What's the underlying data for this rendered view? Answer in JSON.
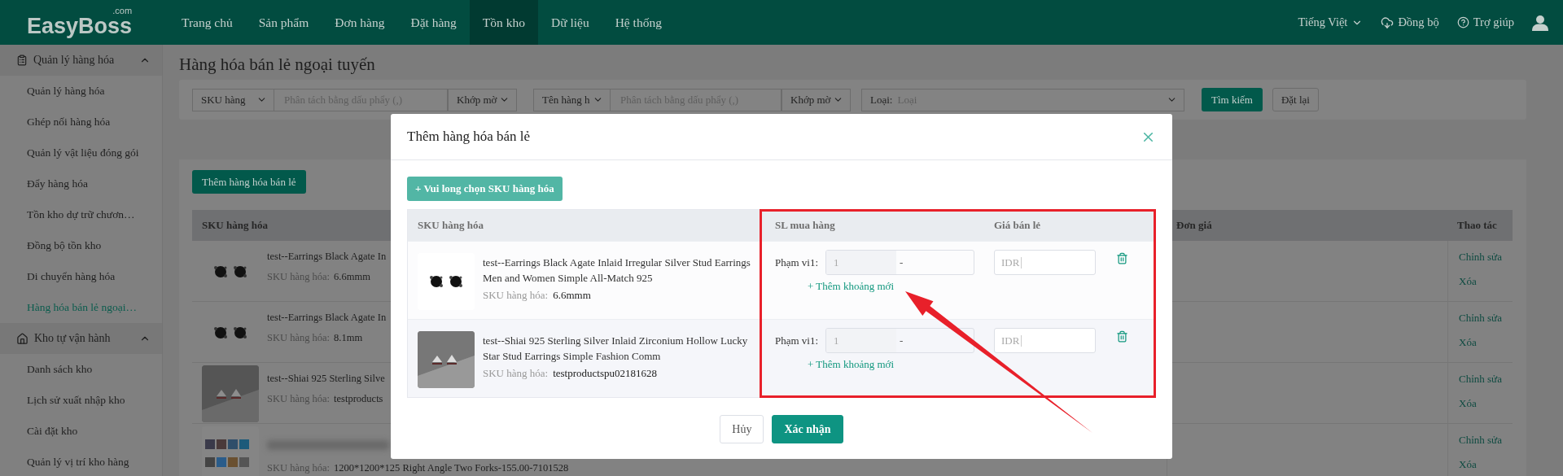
{
  "header": {
    "logo": "EasyBoss",
    "logo_suffix": ".com",
    "nav": [
      {
        "label": "Trang chủ",
        "selected": false
      },
      {
        "label": "Sản phẩm",
        "selected": false
      },
      {
        "label": "Đơn hàng",
        "selected": false
      },
      {
        "label": "Đặt hàng",
        "selected": false
      },
      {
        "label": "Tồn kho",
        "selected": true
      },
      {
        "label": "Dữ liệu",
        "selected": false
      },
      {
        "label": "Hệ thống",
        "selected": false
      }
    ],
    "language": "Tiếng Việt",
    "actions": [
      {
        "kind": "sync",
        "label": "Đồng bộ"
      },
      {
        "kind": "help",
        "label": "Trợ giúp"
      }
    ]
  },
  "sidebar": {
    "groups": [
      {
        "kind": "goods",
        "label": "Quản lý hàng hóa",
        "expanded": true,
        "children": [
          {
            "label": "Quản lý hàng hóa",
            "selected": false
          },
          {
            "label": "Ghép nối hàng hóa",
            "selected": false
          },
          {
            "label": "Quản lý vật liệu đóng gói",
            "selected": false
          },
          {
            "label": "Đẩy hàng hóa",
            "selected": false
          },
          {
            "label": "Tồn kho dự trữ chươn…",
            "selected": false
          },
          {
            "label": "Đồng bộ tồn kho",
            "selected": false
          },
          {
            "label": "Di chuyển hàng hóa",
            "selected": false
          },
          {
            "label": "Hàng hóa bán lẻ ngoại…",
            "selected": true
          }
        ]
      },
      {
        "kind": "warehouse",
        "label": "Kho tự vận hành",
        "expanded": true,
        "children": [
          {
            "label": "Danh sách kho",
            "selected": false
          },
          {
            "label": "Lịch sử xuất nhập kho",
            "selected": false
          },
          {
            "label": "Cài đặt kho",
            "selected": false
          },
          {
            "label": "Quản lý vị trí kho hàng",
            "selected": false
          }
        ]
      }
    ]
  },
  "page": {
    "title": "Hàng hóa bán lẻ ngoại tuyến",
    "filters": [
      {
        "kind": "select",
        "value": "SKU hàng"
      },
      {
        "kind": "input",
        "placeholder": "Phân tách bằng dấu phẩy (,)"
      },
      {
        "kind": "select",
        "value": "Khớp mờ"
      },
      {
        "kind": "select",
        "value": "Tên hàng h"
      },
      {
        "kind": "input",
        "placeholder": "Phân tách bằng dấu phẩy (,)"
      },
      {
        "kind": "select",
        "value": "Khớp mờ"
      },
      {
        "kind": "labeled_select",
        "label": "Loại:",
        "placeholder": "Loại"
      }
    ],
    "search_button": "Tìm kiếm",
    "reset_button": "Đặt lại",
    "add_button": "Thêm hàng hóa bán lẻ",
    "table": {
      "columns": [
        "SKU hàng hóa",
        "Đơn giá",
        "Thao tác"
      ],
      "rows": [
        {
          "kind": "earrings",
          "blurred": false,
          "title": "test--Earrings Black Agate In",
          "sku_label": "SKU hàng hóa:",
          "sku": "6.6mmm",
          "actions": [
            "Chỉnh sửa",
            "Xóa"
          ]
        },
        {
          "kind": "earrings",
          "blurred": false,
          "title": "test--Earrings Black Agate In",
          "sku_label": "SKU hàng hóa:",
          "sku": "8.1mm",
          "actions": [
            "Chỉnh sửa",
            "Xóa"
          ]
        },
        {
          "blurred": false,
          "title": "test--Shiai 925 Sterling Silve",
          "sku_label": "SKU hàng hóa:",
          "sku": "testproducts",
          "actions": [
            "Chỉnh sửa",
            "Xóa"
          ]
        },
        {
          "kind": "collage",
          "blurred": true,
          "sku_label": "SKU hàng hóa:",
          "sku": "1200*1200*125 Right Angle Two Forks-155.00-7101528",
          "actions": [
            "Chỉnh sửa",
            "Xóa"
          ]
        }
      ]
    }
  },
  "dialog": {
    "title": "Thêm hàng hóa bán lẻ",
    "select_button": "+ Vui long chọn SKU hàng hóa",
    "columns": [
      "SKU hàng hóa",
      "SL mua hàng",
      "Giá bán lẻ"
    ],
    "rows": [
      {
        "kind": "earrings",
        "title": "test--Earrings Black Agate Inlaid Irregular Silver Stud Earrings Men and Women Simple All-Match 925",
        "sku_label": "SKU hàng hóa:",
        "sku": "6.6mmm",
        "range_label": "Phạm vi1:",
        "min": "1",
        "separator": "-",
        "add_label": "+ Thêm khoảng mới",
        "price_prefix": "IDR"
      },
      {
        "title": "test--Shiai 925 Sterling Silver Inlaid Zirconium Hollow Lucky Star Stud Earrings Simple Fashion Comm",
        "sku_label": "SKU hàng hóa:",
        "sku": "testproductspu02181628",
        "range_label": "Phạm vi1:",
        "min": "1",
        "separator": "-",
        "add_label": "+ Thêm khoảng mới",
        "price_prefix": "IDR"
      }
    ],
    "buttons": [
      {
        "kind": "cancel",
        "label": "Hủy"
      },
      {
        "kind": "confirm",
        "label": "Xác nhận"
      }
    ]
  }
}
